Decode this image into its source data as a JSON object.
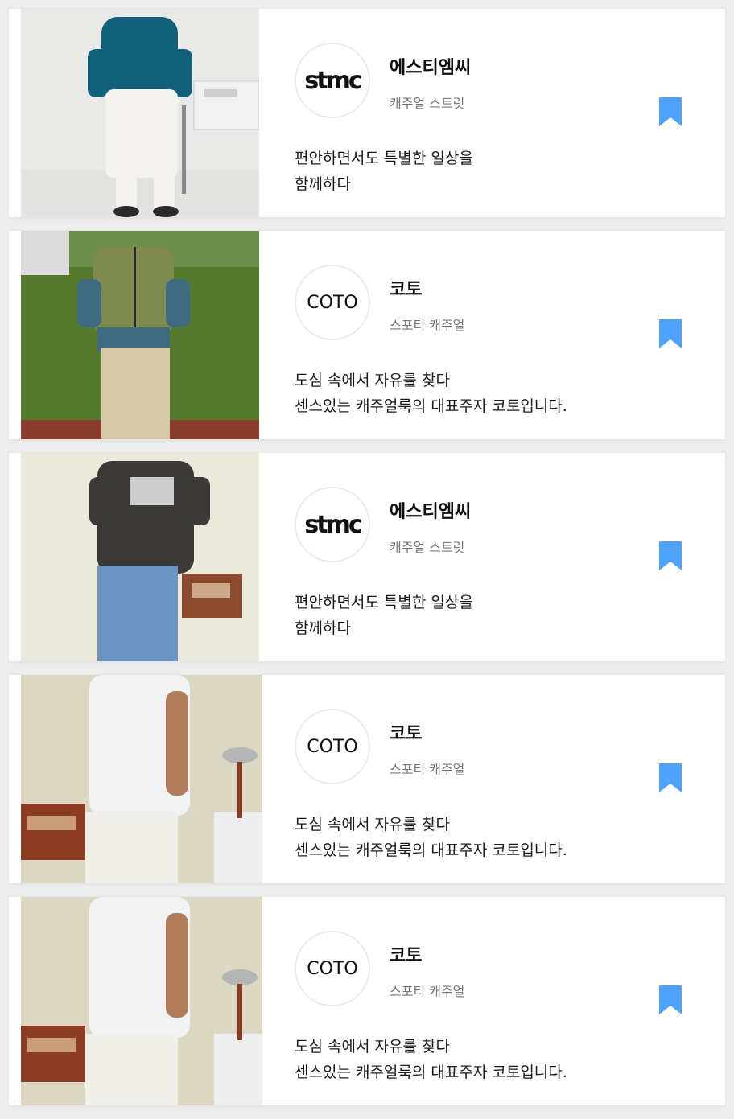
{
  "cards": [
    {
      "brand": "에스티엠씨",
      "category": "캐주얼 스트릿",
      "logo_text": "stmc",
      "description_line1": "편안하면서도 특별한 일상을",
      "description_line2": "함께하다",
      "bookmark_icon": "bookmark-icon",
      "bookmark_color": "#4da3ff"
    },
    {
      "brand": "코토",
      "category": "스포티 캐주얼",
      "logo_text": "COTO",
      "description_line1": "도심 속에서 자유를 찾다",
      "description_line2": "센스있는 캐주얼룩의 대표주자 코토입니다.",
      "bookmark_icon": "bookmark-icon",
      "bookmark_color": "#4da3ff"
    },
    {
      "brand": "에스티엠씨",
      "category": "캐주얼 스트릿",
      "logo_text": "stmc",
      "description_line1": "편안하면서도 특별한 일상을",
      "description_line2": "함께하다",
      "bookmark_icon": "bookmark-icon",
      "bookmark_color": "#4da3ff"
    },
    {
      "brand": "코토",
      "category": "스포티 캐주얼",
      "logo_text": "COTO",
      "description_line1": "도심 속에서 자유를 찾다",
      "description_line2": "센스있는 캐주얼룩의 대표주자 코토입니다.",
      "bookmark_icon": "bookmark-icon",
      "bookmark_color": "#4da3ff"
    },
    {
      "brand": "코토",
      "category": "스포티 캐주얼",
      "logo_text": "COTO",
      "description_line1": "도심 속에서 자유를 찾다",
      "description_line2": "센스있는 캐주얼룩의 대표주자 코토입니다.",
      "bookmark_icon": "bookmark-icon",
      "bookmark_color": "#4da3ff"
    }
  ]
}
